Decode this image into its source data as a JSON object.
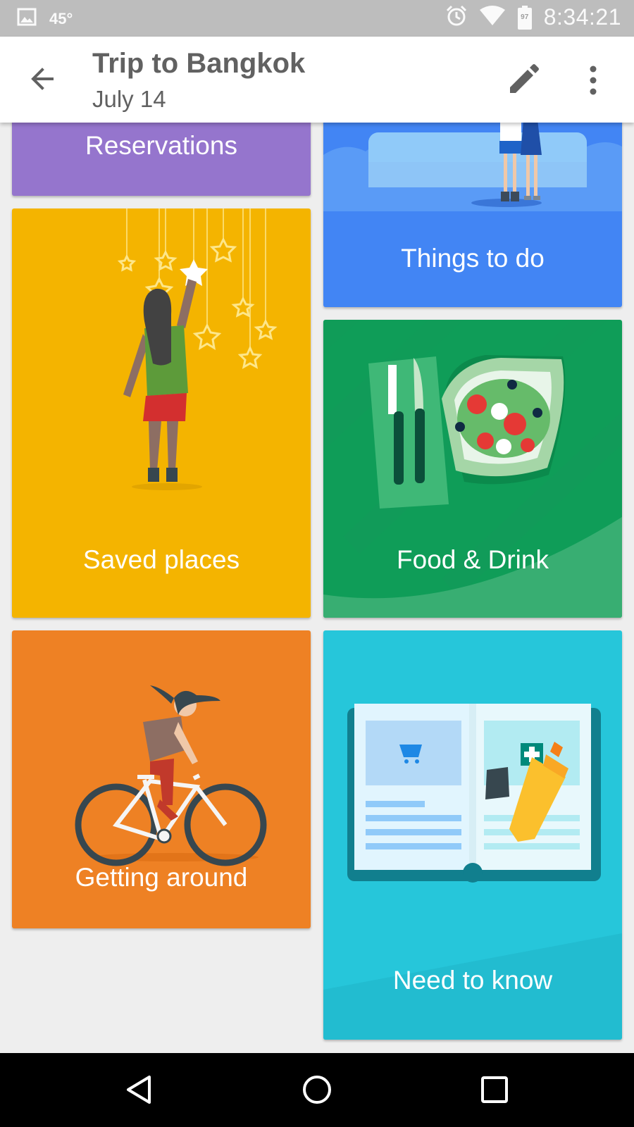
{
  "status_bar": {
    "temperature": "45°",
    "time": "8:34:21",
    "battery_level": "97",
    "icons": [
      "image-icon",
      "alarm-icon",
      "wifi-icon",
      "battery-icon"
    ]
  },
  "app_bar": {
    "title": "Trip to Bangkok",
    "subtitle": "July 14",
    "icons": [
      "back-arrow-icon",
      "edit-pencil-icon",
      "more-vert-icon"
    ]
  },
  "cards": {
    "reservations": {
      "label": "Reservations",
      "color": "#9575cd"
    },
    "things_to_do": {
      "label": "Things to do",
      "color": "#4285f4"
    },
    "saved_places": {
      "label": "Saved places",
      "color": "#f4b400"
    },
    "food_drink": {
      "label": "Food & Drink",
      "color": "#0f9d58"
    },
    "getting_around": {
      "label": "Getting around",
      "color": "#ee8124"
    },
    "need_to_know": {
      "label": "Need to know",
      "color": "#26c6da"
    }
  },
  "nav_bar": {
    "icons": [
      "back-triangle-icon",
      "home-circle-icon",
      "recents-square-icon"
    ]
  }
}
